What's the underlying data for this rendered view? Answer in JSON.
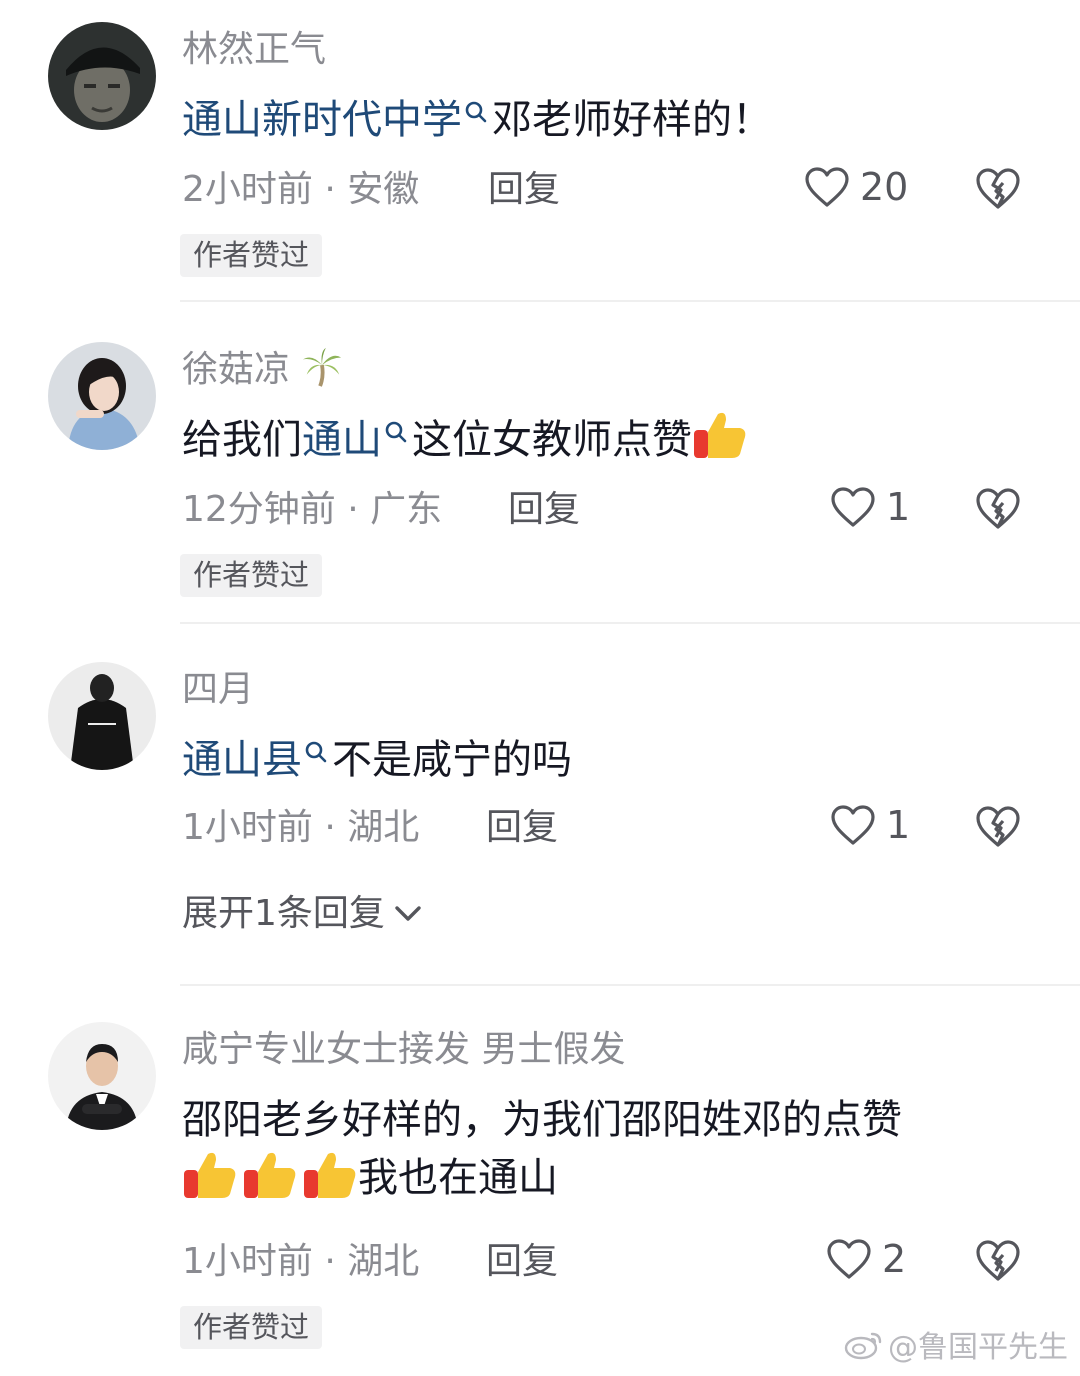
{
  "comments": [
    {
      "username": "林然正气",
      "text_link": "通山新时代中学",
      "text_rest": "邓老师好样的！",
      "time": "2小时前",
      "location": "安徽",
      "reply_label": "回复",
      "likes": "20",
      "badge": "作者赞过"
    },
    {
      "username": "徐菇凉",
      "username_emoji": "palm-tree-icon",
      "text_prefix": "给我们",
      "text_link": "通山",
      "text_rest": "这位女教师点赞",
      "time": "12分钟前",
      "location": "广东",
      "reply_label": "回复",
      "likes": "1",
      "badge": "作者赞过"
    },
    {
      "username": "四月",
      "text_link": "通山县",
      "text_rest": "不是咸宁的吗",
      "time": "1小时前",
      "location": "湖北",
      "reply_label": "回复",
      "likes": "1",
      "expand_label": "展开1条回复"
    },
    {
      "username": "咸宁专业女士接发  男士假发",
      "text_line1": "邵阳老乡好样的，为我们邵阳姓邓的点赞",
      "text_line2": "我也在通山",
      "time": "1小时前",
      "location": "湖北",
      "reply_label": "回复",
      "likes": "2",
      "badge": "作者赞过"
    }
  ],
  "separator": " · ",
  "watermark": "@鲁国平先生",
  "colors": {
    "link": "#1f4a78",
    "meta": "#8a8b91",
    "text": "#161823",
    "badge_bg": "#f1f1f2"
  }
}
